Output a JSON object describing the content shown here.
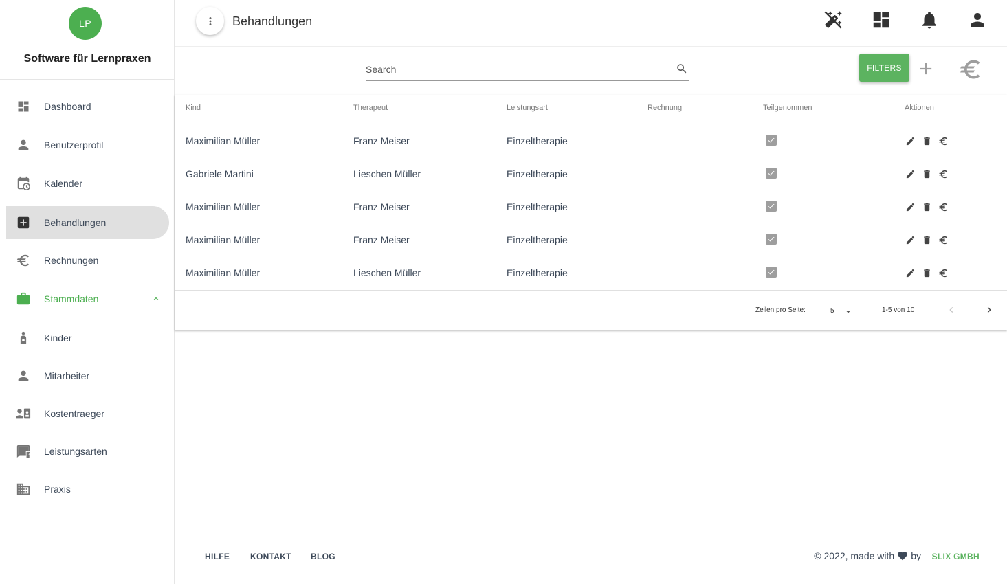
{
  "sidebar": {
    "avatar_initials": "LP",
    "brand": "Software für Lernpraxen",
    "items": [
      {
        "label": "Dashboard",
        "icon": "dashboard-icon"
      },
      {
        "label": "Benutzerprofil",
        "icon": "person-icon"
      },
      {
        "label": "Kalender",
        "icon": "calendar-clock-icon"
      },
      {
        "label": "Behandlungen",
        "icon": "medical-plus-icon",
        "active": true
      },
      {
        "label": "Rechnungen",
        "icon": "euro-icon"
      },
      {
        "label": "Stammdaten",
        "icon": "briefcase-icon",
        "expanded": true
      },
      {
        "label": "Kinder",
        "icon": "child-icon"
      },
      {
        "label": "Mitarbeiter",
        "icon": "person-icon"
      },
      {
        "label": "Kostentraeger",
        "icon": "contact-card-icon"
      },
      {
        "label": "Leistungsarten",
        "icon": "feedback-icon"
      },
      {
        "label": "Praxis",
        "icon": "building-icon"
      }
    ]
  },
  "header": {
    "title": "Behandlungen",
    "icons": [
      "auto-fix-off-icon",
      "dashboard-icon",
      "bell-icon",
      "person-icon"
    ]
  },
  "toolbar": {
    "search_placeholder": "Search",
    "filters_label": "FILTERS"
  },
  "table": {
    "columns": [
      "Kind",
      "Therapeut",
      "Leistungsart",
      "Rechnung",
      "Teilgenommen",
      "Aktionen"
    ],
    "rows": [
      {
        "kind": "Maximilian Müller",
        "therapeut": "Franz Meiser",
        "leistungsart": "Einzeltherapie",
        "rechnung": "",
        "teilgenommen": true
      },
      {
        "kind": "Gabriele Martini",
        "therapeut": "Lieschen Müller",
        "leistungsart": "Einzeltherapie",
        "rechnung": "",
        "teilgenommen": true
      },
      {
        "kind": "Maximilian Müller",
        "therapeut": "Franz Meiser",
        "leistungsart": "Einzeltherapie",
        "rechnung": "",
        "teilgenommen": true
      },
      {
        "kind": "Maximilian Müller",
        "therapeut": "Franz Meiser",
        "leistungsart": "Einzeltherapie",
        "rechnung": "",
        "teilgenommen": true
      },
      {
        "kind": "Maximilian Müller",
        "therapeut": "Lieschen Müller",
        "leistungsart": "Einzeltherapie",
        "rechnung": "",
        "teilgenommen": true
      }
    ],
    "pagination": {
      "rows_per_page_label": "Zeilen pro Seite:",
      "rows_per_page": "5",
      "range": "1-5 von 10"
    }
  },
  "footer": {
    "links": [
      "HILFE",
      "KONTAKT",
      "BLOG"
    ],
    "copyright_prefix": "© 2022, made with",
    "copyright_suffix": "by",
    "company": "SLIX GMBH"
  },
  "colors": {
    "accent": "#4caf50",
    "filters_button": "#5cb360",
    "active_nav_bg": "#e0e0e0"
  }
}
